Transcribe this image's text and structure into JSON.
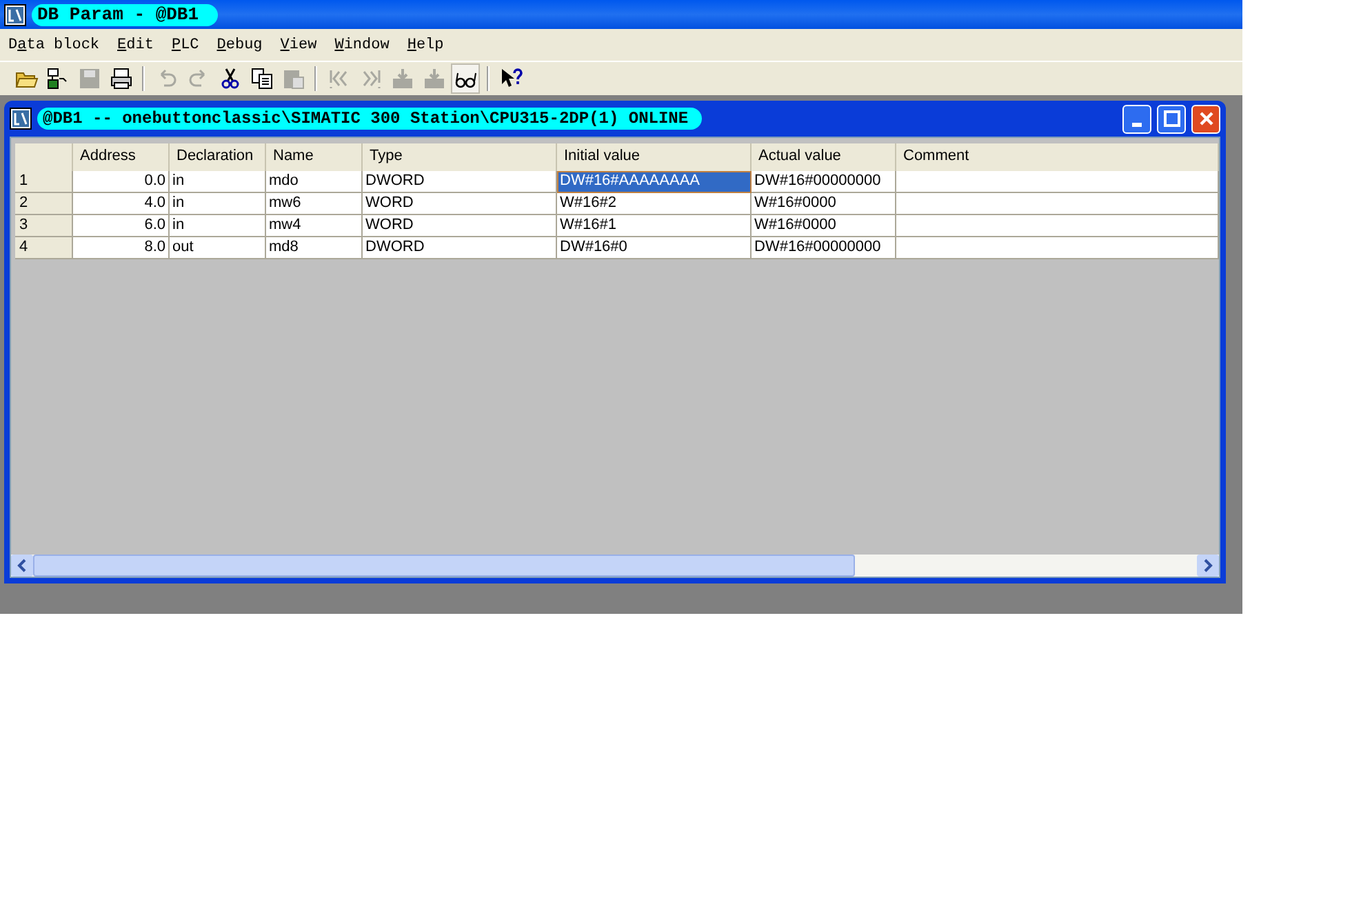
{
  "window": {
    "title": "DB Param - @DB1"
  },
  "menu": [
    {
      "before": "D",
      "key": "a",
      "after": "ta block"
    },
    {
      "key": "E",
      "after": "dit"
    },
    {
      "key": "P",
      "after": "LC"
    },
    {
      "key": "D",
      "after": "ebug"
    },
    {
      "key": "V",
      "after": "iew"
    },
    {
      "key": "W",
      "after": "indow"
    },
    {
      "key": "H",
      "after": "elp"
    }
  ],
  "toolbar": [
    {
      "kind": "open",
      "disabled": false,
      "pressed": false
    },
    {
      "kind": "network",
      "disabled": false,
      "pressed": false
    },
    {
      "kind": "save",
      "disabled": true,
      "pressed": false
    },
    {
      "kind": "print",
      "disabled": false,
      "pressed": false
    },
    {
      "kind": "sep"
    },
    {
      "kind": "undo",
      "disabled": true,
      "pressed": false
    },
    {
      "kind": "redo",
      "disabled": true,
      "pressed": false
    },
    {
      "kind": "cut",
      "disabled": false,
      "pressed": false
    },
    {
      "kind": "copy",
      "disabled": false,
      "pressed": false
    },
    {
      "kind": "paste",
      "disabled": true,
      "pressed": false
    },
    {
      "kind": "sep"
    },
    {
      "kind": "first",
      "disabled": true,
      "pressed": false
    },
    {
      "kind": "last",
      "disabled": true,
      "pressed": false
    },
    {
      "kind": "download",
      "disabled": true,
      "pressed": false
    },
    {
      "kind": "download",
      "disabled": true,
      "pressed": false
    },
    {
      "kind": "glasses",
      "disabled": false,
      "pressed": true
    },
    {
      "kind": "sep"
    },
    {
      "kind": "help",
      "disabled": false,
      "pressed": false
    }
  ],
  "child_window": {
    "title": "@DB1 -- onebuttonclassic\\SIMATIC 300 Station\\CPU315-2DP(1)  ONLINE"
  },
  "table": {
    "columns": [
      "",
      "Address",
      "Declaration",
      "Name",
      "Type",
      "Initial value",
      "Actual value",
      "Comment"
    ],
    "rows": [
      {
        "cells": [
          {
            "text": "1",
            "selected": false
          },
          {
            "text": "0.0",
            "selected": false
          },
          {
            "text": "in",
            "selected": false
          },
          {
            "text": "mdo",
            "selected": false
          },
          {
            "text": "DWORD",
            "selected": false
          },
          {
            "text": "DW#16#AAAAAAAA",
            "selected": true
          },
          {
            "text": "DW#16#00000000",
            "selected": false
          },
          {
            "text": "",
            "selected": false
          }
        ]
      },
      {
        "cells": [
          {
            "text": "2",
            "selected": false
          },
          {
            "text": "4.0",
            "selected": false
          },
          {
            "text": "in",
            "selected": false
          },
          {
            "text": "mw6",
            "selected": false
          },
          {
            "text": "WORD",
            "selected": false
          },
          {
            "text": "W#16#2",
            "selected": false
          },
          {
            "text": "W#16#0000",
            "selected": false
          },
          {
            "text": "",
            "selected": false
          }
        ]
      },
      {
        "cells": [
          {
            "text": "3",
            "selected": false
          },
          {
            "text": "6.0",
            "selected": false
          },
          {
            "text": "in",
            "selected": false
          },
          {
            "text": "mw4",
            "selected": false
          },
          {
            "text": "WORD",
            "selected": false
          },
          {
            "text": "W#16#1",
            "selected": false
          },
          {
            "text": "W#16#0000",
            "selected": false
          },
          {
            "text": "",
            "selected": false
          }
        ]
      },
      {
        "cells": [
          {
            "text": "4",
            "selected": false
          },
          {
            "text": "8.0",
            "selected": false
          },
          {
            "text": "out",
            "selected": false
          },
          {
            "text": "md8",
            "selected": false
          },
          {
            "text": "DWORD",
            "selected": false
          },
          {
            "text": "DW#16#0",
            "selected": false
          },
          {
            "text": "DW#16#00000000",
            "selected": false
          },
          {
            "text": "",
            "selected": false
          }
        ]
      }
    ]
  }
}
